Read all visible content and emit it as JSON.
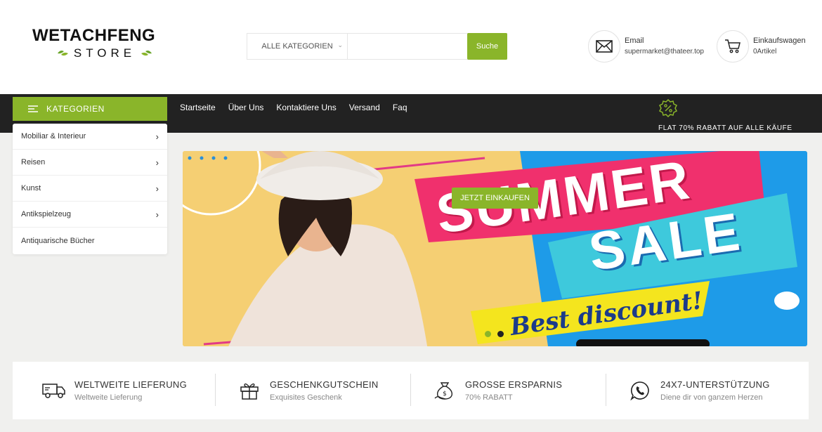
{
  "logo": {
    "main": "WETACHFENG",
    "sub": "STORE"
  },
  "search": {
    "category": "ALLE KATEGORIEN",
    "placeholder": "",
    "button": "Suche"
  },
  "header_info": {
    "email": {
      "label": "Email",
      "value": "supermarket@thateer.top",
      "icon": "envelope-icon"
    },
    "cart": {
      "label": "Einkaufswagen",
      "value": "0Artikel",
      "icon": "cart-icon"
    }
  },
  "nav": {
    "categories_button": "KATEGORIEN",
    "links": [
      "Startseite",
      "Über Uns",
      "Kontaktiere Uns",
      "Versand",
      "Faq"
    ],
    "promo": "FLAT 70% RABATT AUF ALLE KÄUFE"
  },
  "categories": [
    {
      "label": "Mobiliar & Interieur",
      "has_sub": true
    },
    {
      "label": "Reisen",
      "has_sub": true
    },
    {
      "label": "Kunst",
      "has_sub": true
    },
    {
      "label": "Antikspielzeug",
      "has_sub": true
    },
    {
      "label": "Antiquarische Bücher",
      "has_sub": false
    }
  ],
  "banner": {
    "button": "JETZT EINKAUFEN",
    "headline_1": "SUMMER",
    "headline_2": "SALE",
    "tagline": "Best discount!",
    "slides": 2,
    "active_slide": 1
  },
  "features": [
    {
      "title": "WELTWEITE LIEFERUNG",
      "subtitle": "Weltweite Lieferung",
      "icon": "truck-icon"
    },
    {
      "title": "GESCHENKGUTSCHEIN",
      "subtitle": "Exquisites Geschenk",
      "icon": "gift-icon"
    },
    {
      "title": "GROSSE ERSPARNIS",
      "subtitle": "70% RABATT",
      "icon": "money-bag-icon"
    },
    {
      "title": "24X7-UNTERSTÜTZUNG",
      "subtitle": "Diene dir von ganzem Herzen",
      "icon": "whatsapp-icon"
    }
  ],
  "colors": {
    "accent": "#8ab52a",
    "nav_bg": "#222222",
    "page_bg": "#f0f0ee"
  }
}
